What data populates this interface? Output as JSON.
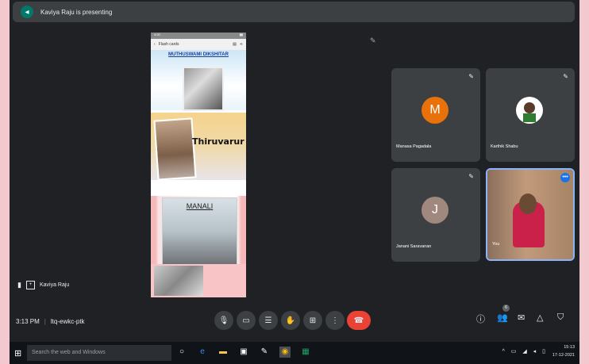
{
  "banner": {
    "back_icon": "◂",
    "text": "Kaviya Raju is presenting"
  },
  "phone": {
    "status_left": "4:20",
    "status_right": "▮▮",
    "app_title": "Flash cards",
    "cards": [
      {
        "heading": "MUTHUSWAMI DIKSHITAR"
      },
      {
        "heading": "Thiruvarur"
      },
      {
        "heading": "MANALI"
      },
      {
        "heading": ""
      }
    ]
  },
  "participants": [
    {
      "name": "Manasa Pagadala",
      "initial": "M",
      "color": "#e8710a"
    },
    {
      "name": "Karthik Shabu",
      "initial": "",
      "color": "#ffffff"
    },
    {
      "name": "Janani Saravanan",
      "initial": "J",
      "color": "#a1887f"
    },
    {
      "name": "You",
      "initial": "",
      "color": ""
    }
  ],
  "presenter": {
    "name": "Kaviya Raju"
  },
  "meeting": {
    "time": "3:13 PM",
    "code": "ltq-ewkc-ptk",
    "people_count": "6"
  },
  "taskbar": {
    "search_placeholder": "Search the web and Windows",
    "time": "15:13",
    "date": "17-12-2021"
  },
  "colors": {
    "background": "#202124",
    "tile": "#3c4043",
    "hangup": "#ea4335",
    "accent": "#1a73e8"
  }
}
